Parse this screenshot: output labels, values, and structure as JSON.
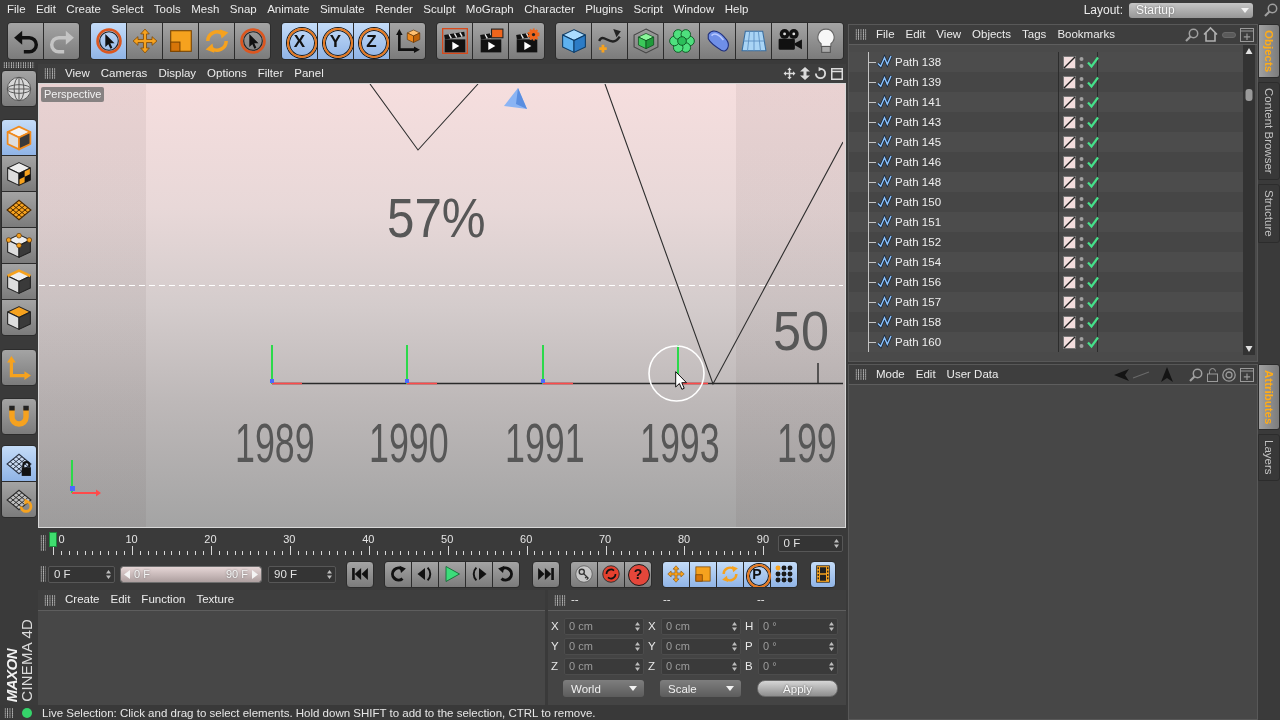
{
  "menu_bar": {
    "items": [
      "File",
      "Edit",
      "Create",
      "Select",
      "Tools",
      "Mesh",
      "Snap",
      "Animate",
      "Simulate",
      "Render",
      "Sculpt",
      "MoGraph",
      "Character",
      "Plugins",
      "Script",
      "Window",
      "Help"
    ]
  },
  "layout_selector": {
    "label": "Layout:",
    "value": "Startup"
  },
  "toolbar": {
    "groups": [
      [
        {
          "kind": "undo",
          "on": false,
          "disabled": false
        },
        {
          "kind": "redo",
          "on": false,
          "disabled": true
        }
      ],
      [
        {
          "kind": "live-selection",
          "on": true
        },
        {
          "kind": "move",
          "on": false
        },
        {
          "kind": "scale",
          "on": false
        },
        {
          "kind": "rotate",
          "on": false
        },
        {
          "kind": "last-tool",
          "on": false
        }
      ],
      [
        {
          "kind": "axis",
          "label": "X",
          "on": true
        },
        {
          "kind": "axis",
          "label": "Y",
          "on": true
        },
        {
          "kind": "axis",
          "label": "Z",
          "on": true
        },
        {
          "kind": "coordinate-system",
          "on": false
        }
      ],
      [
        {
          "kind": "render-view",
          "on": false
        },
        {
          "kind": "render-picture",
          "on": false
        },
        {
          "kind": "render-settings",
          "on": false
        }
      ],
      [
        {
          "kind": "cube",
          "on": false
        },
        {
          "kind": "pen",
          "on": false
        },
        {
          "kind": "subdivision",
          "on": false
        },
        {
          "kind": "cloner",
          "on": false
        },
        {
          "kind": "deformer",
          "on": false
        },
        {
          "kind": "floor",
          "on": false
        },
        {
          "kind": "camera",
          "on": false
        },
        {
          "kind": "light",
          "on": false
        }
      ]
    ]
  },
  "mode_toolbar": {
    "groups": [
      [
        {
          "kind": "make-editable",
          "on": false
        }
      ],
      [
        {
          "kind": "model",
          "on": true
        },
        {
          "kind": "texture",
          "on": false
        },
        {
          "kind": "workplane-grid",
          "on": false
        },
        {
          "kind": "points",
          "on": false
        },
        {
          "kind": "edges",
          "on": false
        },
        {
          "kind": "polygons",
          "on": false
        }
      ],
      [
        {
          "kind": "axis-mode",
          "on": false
        }
      ],
      [
        {
          "kind": "snap",
          "on": false
        }
      ],
      [
        {
          "kind": "workplane-lock",
          "on": true
        },
        {
          "kind": "workplane",
          "on": false
        }
      ]
    ]
  },
  "viewport": {
    "menu": [
      "View",
      "Cameras",
      "Display",
      "Options",
      "Filter",
      "Panel"
    ],
    "camera": "Perspective",
    "scene_labels": [
      "57%",
      "50",
      "1989",
      "1990",
      "1991",
      "1993",
      "199"
    ]
  },
  "timeline": {
    "ticks": [
      "0",
      "10",
      "20",
      "30",
      "40",
      "50",
      "60",
      "70",
      "80",
      "90"
    ],
    "level": 0,
    "current_frame": "0 F"
  },
  "playback": {
    "start_frame": "0 F",
    "range": {
      "from": "0 F",
      "to": "90 F",
      "level": 1
    },
    "end_frame": "90 F",
    "groups": [
      [
        {
          "kind": "go-start",
          "on": false
        }
      ],
      [
        {
          "kind": "prev-key",
          "on": false
        },
        {
          "kind": "prev-frame",
          "on": false
        },
        {
          "kind": "play",
          "on": false
        },
        {
          "kind": "next-frame",
          "on": false
        },
        {
          "kind": "next-key",
          "on": false
        }
      ],
      [
        {
          "kind": "go-end",
          "on": false
        }
      ],
      [
        {
          "kind": "record",
          "on": false
        },
        {
          "kind": "autokey",
          "on": false
        },
        {
          "kind": "key-selection",
          "label": "?",
          "on": false
        }
      ],
      [
        {
          "kind": "key-position",
          "on": true
        },
        {
          "kind": "key-scale",
          "on": true
        },
        {
          "kind": "key-rotation",
          "on": true
        },
        {
          "kind": "key-parameter",
          "label": "P",
          "on": true
        },
        {
          "kind": "key-points",
          "on": true
        }
      ],
      [
        {
          "kind": "timeline",
          "on": true
        }
      ]
    ]
  },
  "material_manager": {
    "menu": [
      "Create",
      "Edit",
      "Function",
      "Texture"
    ]
  },
  "coordinates": {
    "headers": [
      "--",
      "--",
      "--"
    ],
    "rows": [
      {
        "fields": [
          {
            "label": "X",
            "value": "0 cm"
          },
          {
            "label": "X",
            "value": "0 cm"
          },
          {
            "label": "H",
            "value": "0 °"
          }
        ]
      },
      {
        "fields": [
          {
            "label": "Y",
            "value": "0 cm"
          },
          {
            "label": "Y",
            "value": "0 cm"
          },
          {
            "label": "P",
            "value": "0 °"
          }
        ]
      },
      {
        "fields": [
          {
            "label": "Z",
            "value": "0 cm"
          },
          {
            "label": "Z",
            "value": "0 cm"
          },
          {
            "label": "B",
            "value": "0 °"
          }
        ]
      }
    ],
    "dropdowns": [
      "World",
      "Scale"
    ],
    "apply": "Apply"
  },
  "logo": {
    "brand": "MAXON",
    "product": "CINEMA 4D"
  },
  "status_bar": {
    "message": "Live Selection: Click and drag to select elements. Hold down SHIFT to add to the selection, CTRL to remove."
  },
  "object_manager": {
    "menu": [
      "File",
      "Edit",
      "View",
      "Objects",
      "Tags",
      "Bookmarks"
    ],
    "objects": [
      {
        "name": "Path 138",
        "enabled": true
      },
      {
        "name": "Path 139",
        "enabled": true
      },
      {
        "name": "Path 141",
        "enabled": true
      },
      {
        "name": "Path 143",
        "enabled": true
      },
      {
        "name": "Path 145",
        "enabled": true
      },
      {
        "name": "Path 146",
        "enabled": true
      },
      {
        "name": "Path 148",
        "enabled": true
      },
      {
        "name": "Path 150",
        "enabled": true
      },
      {
        "name": "Path 151",
        "enabled": true
      },
      {
        "name": "Path 152",
        "enabled": true
      },
      {
        "name": "Path 154",
        "enabled": true
      },
      {
        "name": "Path 156",
        "enabled": true
      },
      {
        "name": "Path 157",
        "enabled": true
      },
      {
        "name": "Path 158",
        "enabled": true
      },
      {
        "name": "Path 160",
        "enabled": true
      }
    ]
  },
  "object_tabs": [
    {
      "label": "Objects",
      "selected": true
    },
    {
      "label": "Content Browser",
      "selected": false
    },
    {
      "label": "Structure",
      "selected": false
    }
  ],
  "attribute_manager": {
    "menu": [
      "Mode",
      "Edit",
      "User Data"
    ]
  },
  "attribute_tabs": [
    {
      "label": "Attributes",
      "selected": true
    },
    {
      "label": "Layers",
      "selected": false
    }
  ]
}
